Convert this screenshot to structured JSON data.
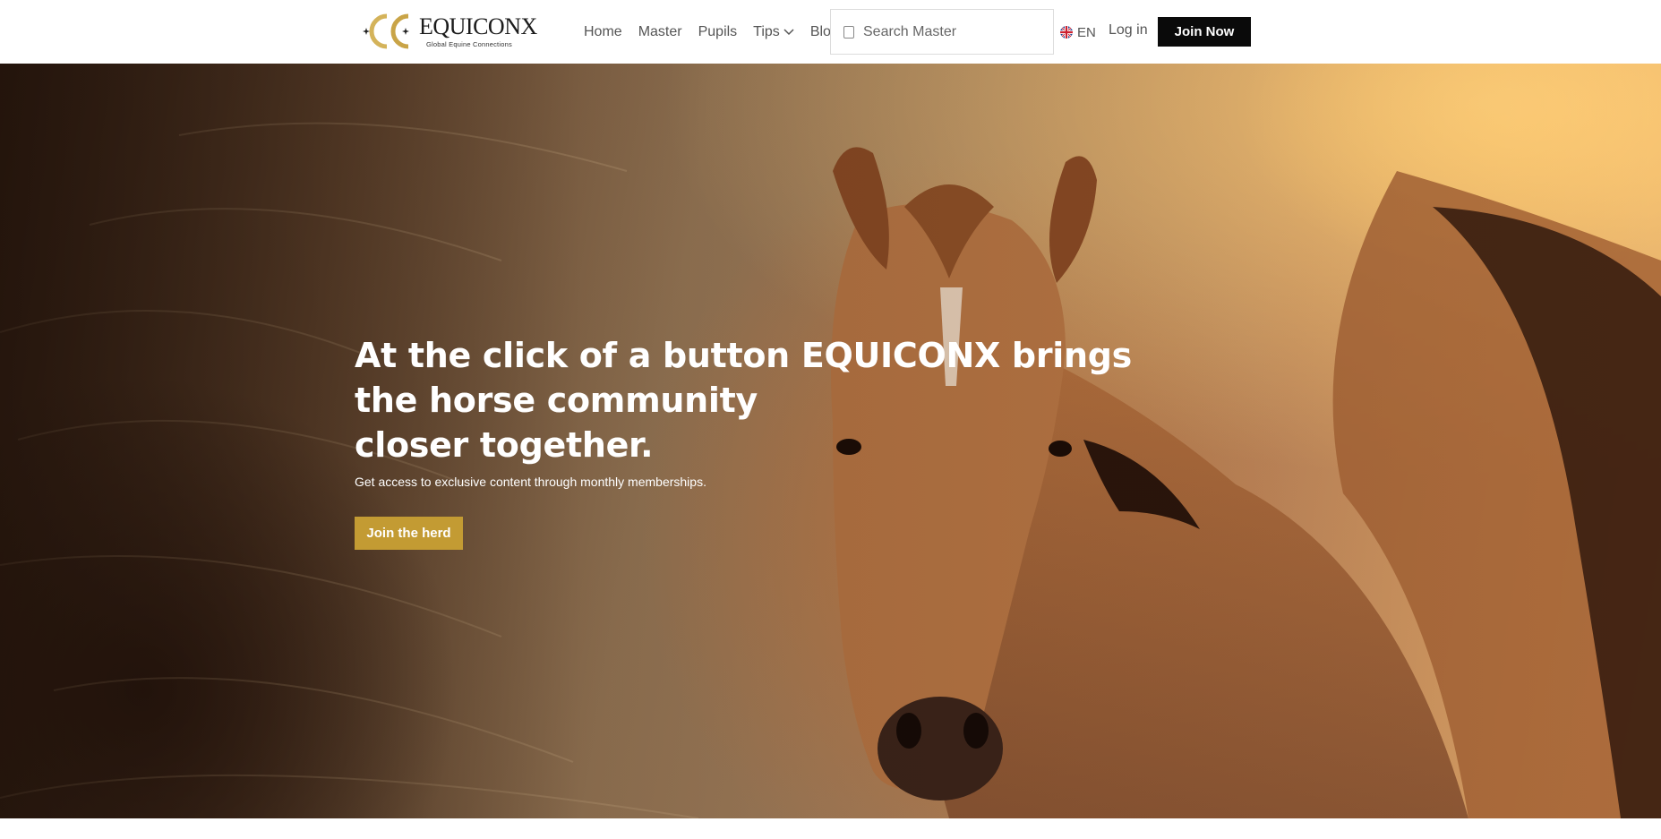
{
  "header": {
    "logo": {
      "wordmark": "EQUICONX",
      "tagline": "Global Equine Connections",
      "accent_color": "#c9a447"
    },
    "nav": [
      {
        "label": "Home"
      },
      {
        "label": "Master"
      },
      {
        "label": "Pupils"
      },
      {
        "label": "Tips",
        "icon": "chevron-down-icon"
      },
      {
        "label": "Blog"
      }
    ],
    "search": {
      "placeholder": "Search Master",
      "value": "",
      "icon": "search-icon"
    },
    "language": {
      "label": "EN",
      "icon": "uk-flag-icon"
    },
    "login_label": "Log in",
    "join_label": "Join Now"
  },
  "hero": {
    "title_lines": [
      "At the click of a button EQUICONX brings",
      "the horse community",
      "closer together."
    ],
    "subtitle": "Get access to exclusive content through monthly memberships.",
    "cta_label": "Join the herd",
    "cta_color": "#c39b33"
  }
}
